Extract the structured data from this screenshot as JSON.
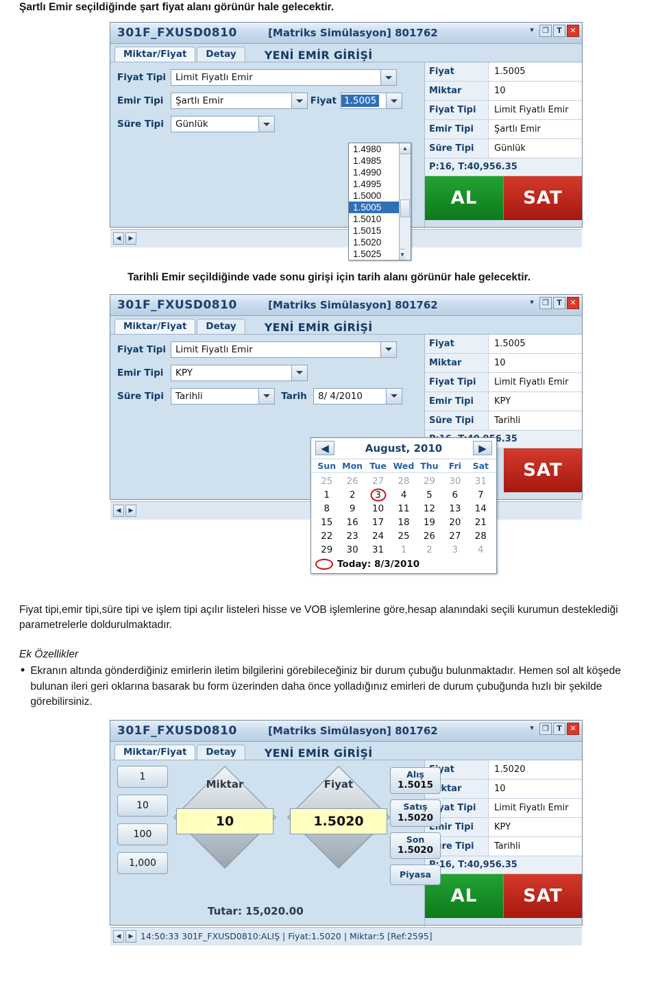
{
  "doc": {
    "para1": "Şartlı Emir seçildiğinde şart fiyat alanı görünür hale gelecektir.",
    "para2": "Tarihli Emir seçildiğinde vade sonu girişi için tarih alanı görünür hale gelecektir.",
    "para3": "Fiyat tipi,emir tipi,süre tipi ve işlem tipi açılır listeleri hisse ve VOB işlemlerine göre,hesap alanındaki seçili kurumun desteklediği parametrelerle doldurulmaktadır.",
    "heading_ek": "Ek Özellikler",
    "bullet1": "Ekranın altında gönderdiğiniz emirlerin iletim bilgilerini görebileceğiniz bir durum çubuğu bulunmaktadır.",
    "bullet1_cont": "Hemen sol alt köşede bulunan ileri geri oklarına basarak bu form üzerinden daha önce yolladığınız emirleri de durum çubuğunda hızlı bir şekilde görebilirsiniz."
  },
  "shot1": {
    "title_code": "301F_FXUSD0810",
    "title_mid": "[Matriks Simülasyon] 801762",
    "titlebar_buttons": [
      "restore-icon",
      "T",
      "close-icon"
    ],
    "tabs": [
      "Miktar/Fiyat",
      "Detay"
    ],
    "form_title": "YENİ EMİR GİRİŞİ",
    "fields": [
      {
        "label": "Fiyat Tipi",
        "value": "Limit Fiyatlı Emir"
      },
      {
        "label": "Emir Tipi",
        "value": "Şartlı Emir"
      },
      {
        "label": "Süre Tipi",
        "value": "Günlük"
      }
    ],
    "fiyat_label": "Fiyat",
    "fiyat_value": "1.5005",
    "price_list": [
      "1.4980",
      "1.4985",
      "1.4990",
      "1.4995",
      "1.5000",
      "1.5005",
      "1.5010",
      "1.5015",
      "1.5020",
      "1.5025"
    ],
    "price_selected": "1.5005",
    "info": [
      {
        "k": "Fiyat",
        "v": "1.5005"
      },
      {
        "k": "Miktar",
        "v": "10"
      },
      {
        "k": "Fiyat Tipi",
        "v": "Limit Fiyatlı Emir"
      },
      {
        "k": "Emir Tipi",
        "v": "Şartlı Emir"
      },
      {
        "k": "Süre Tipi",
        "v": "Günlük"
      }
    ],
    "pline": "P:16, T:40,956.35",
    "buy_label": "AL",
    "sell_label": "SAT",
    "status": ""
  },
  "shot2": {
    "title_code": "301F_FXUSD0810",
    "title_mid": "[Matriks Simülasyon] 801762",
    "tabs": [
      "Miktar/Fiyat",
      "Detay"
    ],
    "form_title": "YENİ EMİR GİRİŞİ",
    "fields": [
      {
        "label": "Fiyat Tipi",
        "value": "Limit Fiyatlı Emir"
      },
      {
        "label": "Emir Tipi",
        "value": "KPY"
      },
      {
        "label": "Süre Tipi",
        "value": "Tarihli"
      }
    ],
    "tarih_label": "Tarih",
    "tarih_value": "8/ 4/2010",
    "calendar": {
      "month": "August, 2010",
      "prev": "◀",
      "next": "▶",
      "dow": [
        "Sun",
        "Mon",
        "Tue",
        "Wed",
        "Thu",
        "Fri",
        "Sat"
      ],
      "weeks": [
        [
          {
            "d": "25",
            "dim": true
          },
          {
            "d": "26",
            "dim": true
          },
          {
            "d": "27",
            "dim": true
          },
          {
            "d": "28",
            "dim": true
          },
          {
            "d": "29",
            "dim": true
          },
          {
            "d": "30",
            "dim": true
          },
          {
            "d": "31",
            "dim": true
          }
        ],
        [
          {
            "d": "1"
          },
          {
            "d": "2"
          },
          {
            "d": "3",
            "circled": true
          },
          {
            "d": "4"
          },
          {
            "d": "5"
          },
          {
            "d": "6"
          },
          {
            "d": "7"
          }
        ],
        [
          {
            "d": "8"
          },
          {
            "d": "9"
          },
          {
            "d": "10"
          },
          {
            "d": "11"
          },
          {
            "d": "12"
          },
          {
            "d": "13"
          },
          {
            "d": "14"
          }
        ],
        [
          {
            "d": "15"
          },
          {
            "d": "16"
          },
          {
            "d": "17"
          },
          {
            "d": "18"
          },
          {
            "d": "19"
          },
          {
            "d": "20"
          },
          {
            "d": "21"
          }
        ],
        [
          {
            "d": "22"
          },
          {
            "d": "23"
          },
          {
            "d": "24"
          },
          {
            "d": "25"
          },
          {
            "d": "26"
          },
          {
            "d": "27"
          },
          {
            "d": "28"
          }
        ],
        [
          {
            "d": "29"
          },
          {
            "d": "30"
          },
          {
            "d": "31"
          },
          {
            "d": "1",
            "dim": true
          },
          {
            "d": "2",
            "dim": true
          },
          {
            "d": "3",
            "dim": true
          },
          {
            "d": "4",
            "dim": true
          }
        ]
      ],
      "today": "Today: 8/3/2010"
    },
    "info": [
      {
        "k": "Fiyat",
        "v": "1.5005"
      },
      {
        "k": "Miktar",
        "v": "10"
      },
      {
        "k": "Fiyat Tipi",
        "v": "Limit Fiyatlı Emir"
      },
      {
        "k": "Emir Tipi",
        "v": "KPY"
      },
      {
        "k": "Süre Tipi",
        "v": "Tarihli"
      }
    ],
    "pline": "P:16, T:40,956.35",
    "sell_label": "SAT"
  },
  "shot3": {
    "title_code": "301F_FXUSD0810",
    "title_mid": "[Matriks Simülasyon] 801762",
    "tabs": [
      "Miktar/Fiyat",
      "Detay"
    ],
    "form_title": "YENİ EMİR GİRİŞİ",
    "qty_buttons": [
      "1",
      "10",
      "100",
      "1,000"
    ],
    "miktar_label": "Miktar",
    "miktar_value": "10",
    "fiyat_label": "Fiyat",
    "fiyat_value": "1.5020",
    "tutar": "Tutar: 15,020.00",
    "quotes": [
      {
        "label": "Alış",
        "value": "1.5015"
      },
      {
        "label": "Satış",
        "value": "1.5020"
      },
      {
        "label": "Son",
        "value": "1.5020"
      }
    ],
    "piyasa_label": "Piyasa",
    "info": [
      {
        "k": "Fiyat",
        "v": "1.5020"
      },
      {
        "k": "Miktar",
        "v": "10"
      },
      {
        "k": "Fiyat Tipi",
        "v": "Limit Fiyatlı Emir"
      },
      {
        "k": "Emir Tipi",
        "v": "KPY"
      },
      {
        "k": "Süre Tipi",
        "v": "Tarihli"
      }
    ],
    "pline": "P:16, T:40,956.35",
    "buy_label": "AL",
    "sell_label": "SAT",
    "status": "14:50:33 301F_FXUSD0810:ALIŞ | Fiyat:1.5020 | Miktar:5 [Ref:2595]"
  }
}
